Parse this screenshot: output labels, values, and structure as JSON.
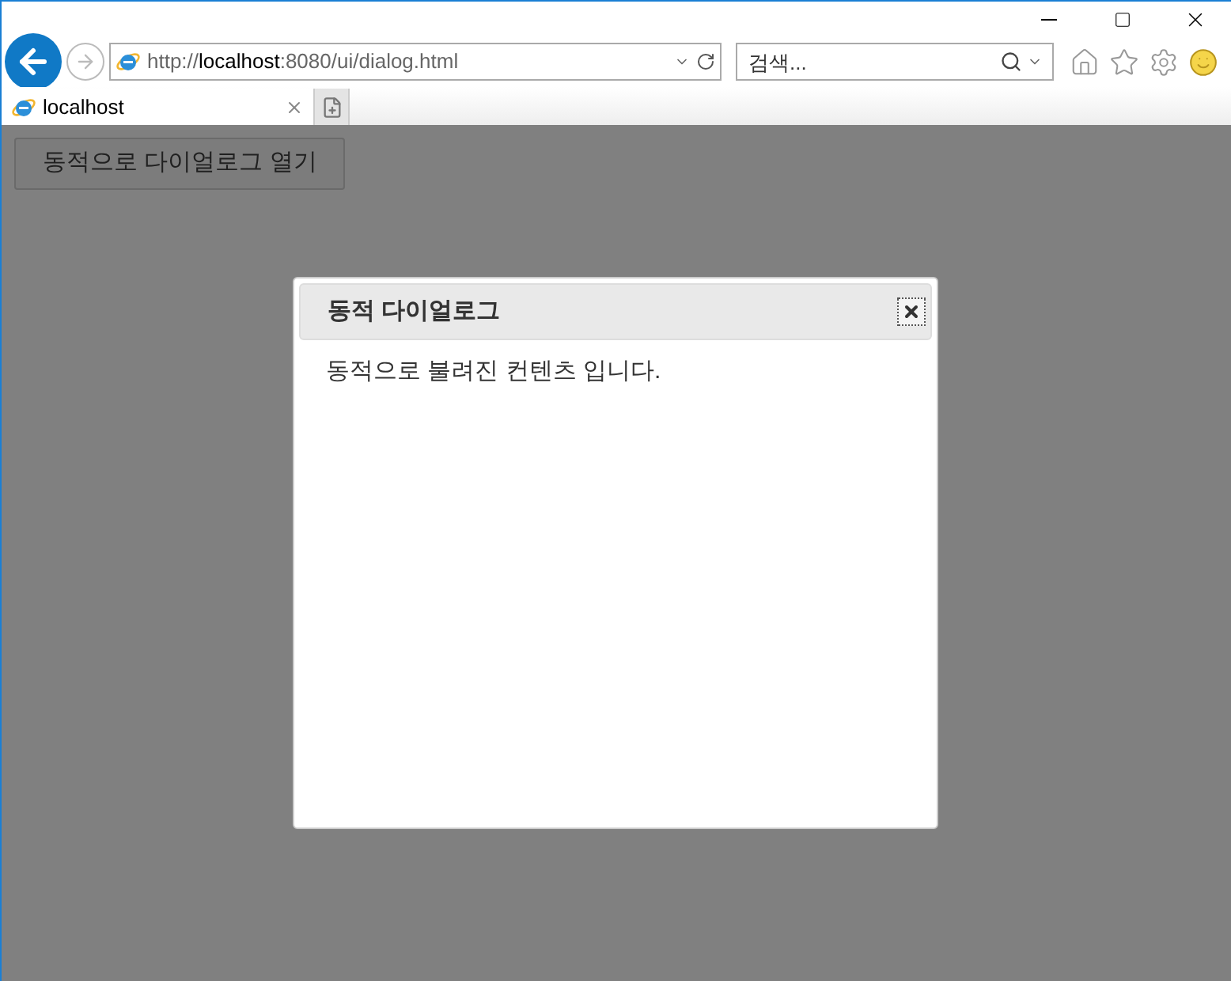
{
  "address_bar": {
    "url_prefix": "http://",
    "url_host": "localhost",
    "url_rest": ":8080/ui/dialog.html"
  },
  "search": {
    "placeholder": "검색..."
  },
  "tabs": [
    {
      "label": "localhost",
      "selected": true
    }
  ],
  "page": {
    "open_button": "동적으로 다이얼로그 열기"
  },
  "dialog": {
    "title": "동적 다이얼로그",
    "content": "동적으로 불려진 컨텐츠 입니다."
  }
}
